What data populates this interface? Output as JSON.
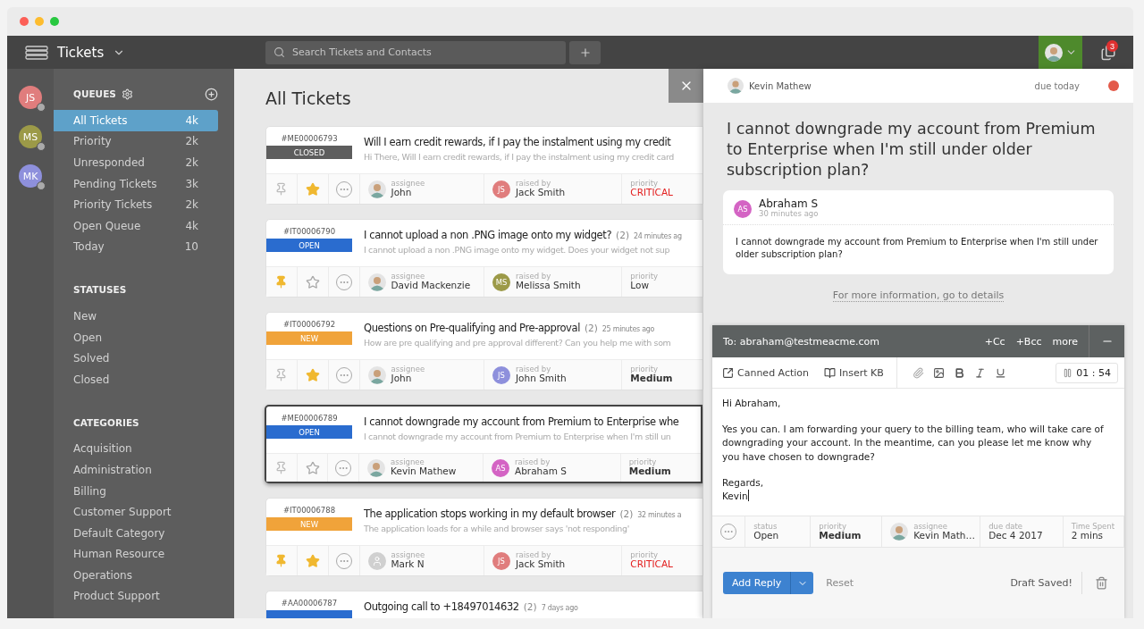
{
  "app": {
    "title": "Tickets",
    "search": {
      "placeholder": "Search Tickets and Contacts"
    },
    "notifications": "3"
  },
  "agents": [
    {
      "initials": "JS",
      "color": "#e07d7d"
    },
    {
      "initials": "MS",
      "color": "#9c9a48"
    },
    {
      "initials": "MK",
      "color": "#8e90dc"
    }
  ],
  "sidebar": {
    "sections": [
      {
        "title": "QUEUES",
        "kind": "queues",
        "items": [
          {
            "label": "All Tickets",
            "count": "4k",
            "selected": true
          },
          {
            "label": "Priority",
            "count": "2k",
            "selected": false
          },
          {
            "label": "Unresponded",
            "count": "2k",
            "selected": false
          },
          {
            "label": "Pending Tickets",
            "count": "3k",
            "selected": false
          },
          {
            "label": "Priority Tickets",
            "count": "2k",
            "selected": false
          },
          {
            "label": "Open Queue",
            "count": "4k",
            "selected": false
          },
          {
            "label": "Today",
            "count": "10",
            "selected": false
          }
        ]
      },
      {
        "title": "STATUSES",
        "kind": "plain",
        "items": [
          {
            "label": "New",
            "selected": false
          },
          {
            "label": "Open",
            "selected": false
          },
          {
            "label": "Solved",
            "selected": false
          },
          {
            "label": "Closed",
            "selected": false
          }
        ]
      },
      {
        "title": "CATEGORIES",
        "kind": "plain",
        "items": [
          {
            "label": "Acquisition",
            "selected": false
          },
          {
            "label": "Administration",
            "selected": false
          },
          {
            "label": "Billing",
            "selected": false
          },
          {
            "label": "Customer Support",
            "selected": false
          },
          {
            "label": "Default Category",
            "selected": false
          },
          {
            "label": "Human Resource",
            "selected": false
          },
          {
            "label": "Operations",
            "selected": false
          },
          {
            "label": "Product Support",
            "selected": false
          }
        ]
      }
    ]
  },
  "list": {
    "title": "All Tickets",
    "tickets": [
      {
        "id": "#ME00006793",
        "status": {
          "kind": "closed",
          "label": "CLOSED"
        },
        "title": "Will I earn credit rewards, if I pay the instalment using my credit",
        "snippet": "Hi There, Will I earn credit rewards, if I pay the instalment using my credit card",
        "selected": false,
        "pinned": false,
        "starred": true,
        "assignee": {
          "label": "assignee",
          "name": "John",
          "avatar": {
            "kind": "photo"
          }
        },
        "raiser": {
          "label": "raised by",
          "name": "Jack Smith",
          "avatar": {
            "kind": "initials",
            "initials": "JS",
            "color": "#e07d7d"
          }
        },
        "priority": {
          "label": "priority",
          "value": "CRITICAL",
          "kind": "critical"
        }
      },
      {
        "id": "#IT00006790",
        "status": {
          "kind": "open",
          "label": "OPEN"
        },
        "title": "I cannot upload a non .PNG image onto my widget?",
        "replies": "(2)",
        "age": "24 minutes ag",
        "snippet": "I cannot upload a non .PNG image onto my widget. Does your widget not sup",
        "selected": false,
        "pinned": true,
        "starred": false,
        "assignee": {
          "label": "assignee",
          "name": "David Mackenzie",
          "avatar": {
            "kind": "photo"
          }
        },
        "raiser": {
          "label": "raised by",
          "name": "Melissa Smith",
          "avatar": {
            "kind": "initials",
            "initials": "MS",
            "color": "#9c9a48"
          }
        },
        "priority": {
          "label": "priority",
          "value": "Low",
          "kind": "low"
        }
      },
      {
        "id": "#IT00006792",
        "status": {
          "kind": "new",
          "label": "NEW"
        },
        "title": "Questions on Pre-qualifying and Pre-approval",
        "replies": "(2)",
        "age": "25 minutes ago",
        "snippet": "How are pre qualifying and pre approval different? Can you help me with som",
        "selected": false,
        "pinned": false,
        "starred": true,
        "assignee": {
          "label": "assignee",
          "name": "John",
          "avatar": {
            "kind": "photo"
          }
        },
        "raiser": {
          "label": "raised by",
          "name": "John Smith",
          "avatar": {
            "kind": "initials",
            "initials": "JS",
            "color": "#8e90dc"
          }
        },
        "priority": {
          "label": "priority",
          "value": "Medium",
          "kind": "medium"
        }
      },
      {
        "id": "#ME00006789",
        "status": {
          "kind": "open",
          "label": "OPEN"
        },
        "title": "I cannot downgrade my account from Premium to Enterprise whe",
        "snippet": "I cannot downgrade my account from Premium to Enterprise when I'm still un",
        "selected": true,
        "pinned": false,
        "starred": false,
        "assignee": {
          "label": "assignee",
          "name": "Kevin Mathew",
          "avatar": {
            "kind": "photo"
          }
        },
        "raiser": {
          "label": "raised by",
          "name": "Abraham S",
          "avatar": {
            "kind": "initials",
            "initials": "AS",
            "color": "#d464c4"
          }
        },
        "priority": {
          "label": "priority",
          "value": "Medium",
          "kind": "medium"
        }
      },
      {
        "id": "#IT00006788",
        "status": {
          "kind": "new",
          "label": "NEW"
        },
        "title": "The application stops working in my default browser",
        "replies": "(2)",
        "age": "32 minutes a",
        "snippet": "The application loads for a while and browser says 'not responding'",
        "selected": false,
        "pinned": true,
        "starred": true,
        "assignee": {
          "label": "assignee",
          "name": "Mark N",
          "avatar": {
            "kind": "blank"
          }
        },
        "raiser": {
          "label": "raised by",
          "name": "Jack Smith",
          "avatar": {
            "kind": "initials",
            "initials": "JS",
            "color": "#e07d7d"
          }
        },
        "priority": {
          "label": "priority",
          "value": "CRITICAL",
          "kind": "critical"
        }
      },
      {
        "id": "#AA00006787",
        "status": {
          "kind": "open"
        },
        "title": "Outgoing call to +18497014632",
        "replies": "(2)",
        "age": "7 days ago",
        "selected": false
      }
    ]
  },
  "detail": {
    "agent": "Kevin Mathew",
    "due": "due today",
    "title": "I cannot downgrade my account from Premium to Enterprise when I'm still under older subscription plan?",
    "message": {
      "author": "Abraham S",
      "initials": "AS",
      "color": "#d464c4",
      "time": "30 minutes ago",
      "body": "I cannot downgrade my account from Premium to Enterprise when I'm still under older subscription plan?"
    },
    "details_link": "For more information, go to details",
    "reply": {
      "to": "To: abraham@testmeacme.com",
      "cc": "+Cc",
      "bcc": "+Bcc",
      "more": "more",
      "canned": "Canned Action",
      "insert_kb": "Insert KB",
      "timer": "01 : 54",
      "body": [
        "Hi Abraham,",
        "Yes you can. I am forwarding your query to the billing team, who will take care of downgrading your account. In the meantime, can you please let me know why you have chosen to downgrade?",
        "Regards,\nKevin"
      ],
      "fields": [
        {
          "kind": "plain",
          "label": "status",
          "value": "Open"
        },
        {
          "kind": "bold",
          "label": "priority",
          "value": "Medium"
        },
        {
          "kind": "person",
          "label": "assignee",
          "value": "Kevin Math…"
        },
        {
          "kind": "plain",
          "label": "due date",
          "value": "Dec 4 2017"
        },
        {
          "kind": "plain",
          "label": "Time Spent",
          "value": "2 mins"
        }
      ],
      "submit": "Add Reply",
      "reset": "Reset",
      "draft": "Draft Saved!"
    }
  }
}
